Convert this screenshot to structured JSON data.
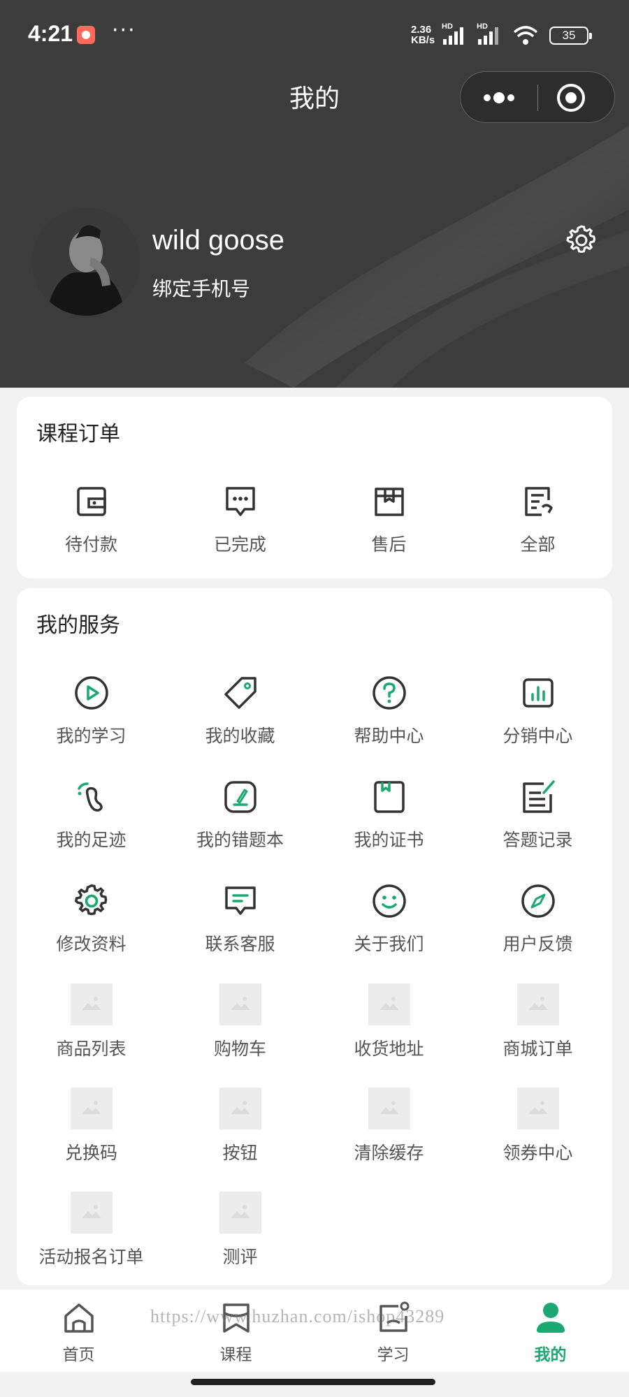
{
  "status_bar": {
    "time": "4:21",
    "more": "···",
    "net_speed_value": "2.36",
    "net_speed_unit": "KB/s",
    "battery": "35"
  },
  "nav": {
    "title": "我的"
  },
  "profile": {
    "username": "wild goose",
    "bind_phone": "绑定手机号"
  },
  "orders": {
    "title": "课程订单",
    "items": [
      {
        "label": "待付款",
        "icon": "wallet-icon"
      },
      {
        "label": "已完成",
        "icon": "chat-dots-icon"
      },
      {
        "label": "售后",
        "icon": "box-icon"
      },
      {
        "label": "全部",
        "icon": "list-icon"
      }
    ]
  },
  "services": {
    "title": "我的服务",
    "items": [
      {
        "label": "我的学习",
        "icon": "play-icon"
      },
      {
        "label": "我的收藏",
        "icon": "tag-icon"
      },
      {
        "label": "帮助中心",
        "icon": "help-icon"
      },
      {
        "label": "分销中心",
        "icon": "bar-chart-icon"
      },
      {
        "label": "我的足迹",
        "icon": "footprint-icon"
      },
      {
        "label": "我的错题本",
        "icon": "edit-icon"
      },
      {
        "label": "我的证书",
        "icon": "bookmark-icon"
      },
      {
        "label": "答题记录",
        "icon": "record-icon"
      },
      {
        "label": "修改资料",
        "icon": "gear-icon"
      },
      {
        "label": "联系客服",
        "icon": "message-icon"
      },
      {
        "label": "关于我们",
        "icon": "smile-icon"
      },
      {
        "label": "用户反馈",
        "icon": "compass-icon"
      },
      {
        "label": "商品列表",
        "icon": "image-placeholder-icon"
      },
      {
        "label": "购物车",
        "icon": "image-placeholder-icon"
      },
      {
        "label": "收货地址",
        "icon": "image-placeholder-icon"
      },
      {
        "label": "商城订单",
        "icon": "image-placeholder-icon"
      },
      {
        "label": "兑换码",
        "icon": "image-placeholder-icon"
      },
      {
        "label": "按钮",
        "icon": "image-placeholder-icon"
      },
      {
        "label": "清除缓存",
        "icon": "image-placeholder-icon"
      },
      {
        "label": "领券中心",
        "icon": "image-placeholder-icon"
      },
      {
        "label": "活动报名订单",
        "icon": "image-placeholder-icon"
      },
      {
        "label": "测评",
        "icon": "image-placeholder-icon"
      }
    ]
  },
  "tabbar": {
    "items": [
      {
        "label": "首页",
        "icon": "home-icon"
      },
      {
        "label": "课程",
        "icon": "bookmark-icon"
      },
      {
        "label": "学习",
        "icon": "study-icon"
      },
      {
        "label": "我的",
        "icon": "user-icon",
        "active": true
      }
    ]
  },
  "watermark": "https://www.huzhan.com/ishop43289",
  "colors": {
    "header_bg": "#3c3c3c",
    "accent": "#1aa970",
    "icon_stroke": "#333333",
    "page_bg": "#f2f2f2"
  }
}
